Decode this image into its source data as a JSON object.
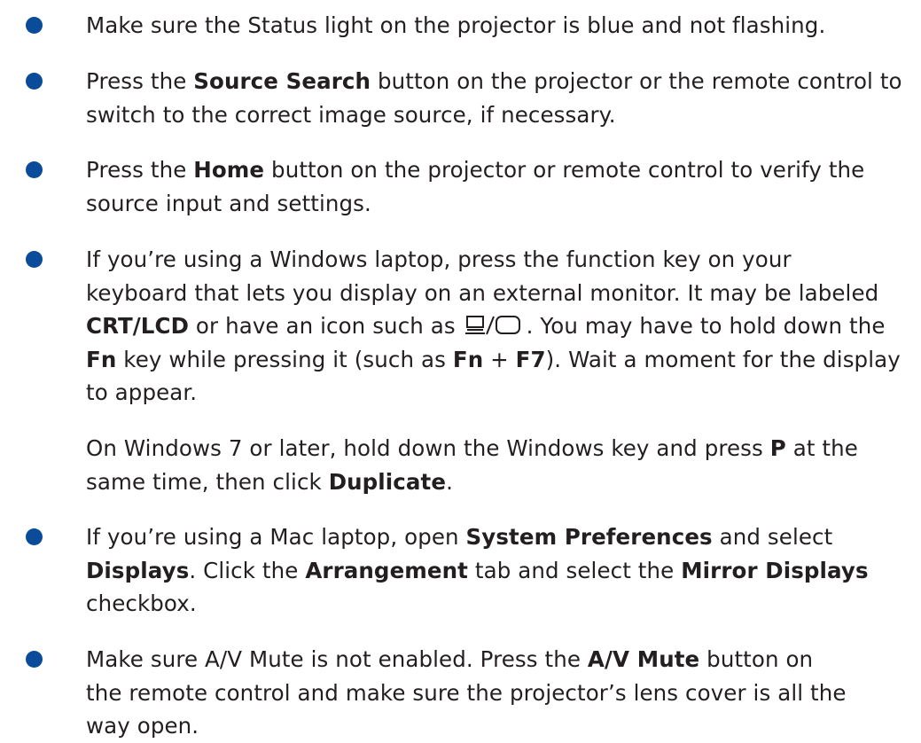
{
  "accent_color": "#0a4c99",
  "items": [
    {
      "lines": [
        [
          {
            "t": "Make sure the Status light on the projector is blue and not flashing."
          }
        ]
      ]
    },
    {
      "lines": [
        [
          {
            "t": "Press the "
          },
          {
            "t": "Source Search",
            "b": true
          },
          {
            "t": " button on the projector or the remote control to"
          }
        ],
        [
          {
            "t": "switch to the correct image source, if necessary."
          }
        ]
      ]
    },
    {
      "lines": [
        [
          {
            "t": "Press the "
          },
          {
            "t": "Home",
            "b": true
          },
          {
            "t": " button on the projector or remote control to verify the"
          }
        ],
        [
          {
            "t": "source input and settings."
          }
        ]
      ]
    },
    {
      "lines": [
        [
          {
            "t": "If you’re using a Windows laptop, press the function key on your"
          }
        ],
        [
          {
            "t": "keyboard that lets you display on an external monitor. It may be labeled"
          }
        ],
        [
          {
            "t": "CRT/LCD",
            "b": true
          },
          {
            "t": " or have an icon such as "
          },
          {
            "icon": "laptop-monitor-icon"
          },
          {
            "t": ". You may have to hold down the"
          }
        ],
        [
          {
            "t": "Fn",
            "b": true
          },
          {
            "t": " key while pressing it (such as "
          },
          {
            "t": "Fn",
            "b": true
          },
          {
            "t": " + "
          },
          {
            "t": "F7",
            "b": true
          },
          {
            "t": "). Wait a moment for the display"
          }
        ],
        [
          {
            "t": "to appear."
          }
        ]
      ]
    },
    {
      "lines": [
        [
          {
            "t": "On Windows 7 or later, hold down the Windows key and press "
          },
          {
            "t": "P",
            "b": true
          },
          {
            "t": " at the"
          }
        ],
        [
          {
            "t": "same time, then click "
          },
          {
            "t": "Duplicate",
            "b": true
          },
          {
            "t": "."
          }
        ]
      ]
    },
    {
      "lines": [
        [
          {
            "t": "If you’re using a Mac laptop, open "
          },
          {
            "t": "System Preferences",
            "b": true
          },
          {
            "t": " and select"
          }
        ],
        [
          {
            "t": "Displays",
            "b": true
          },
          {
            "t": ". Click the "
          },
          {
            "t": "Arrangement",
            "b": true
          },
          {
            "t": " tab and select the "
          },
          {
            "t": "Mirror Displays",
            "b": true
          }
        ],
        [
          {
            "t": "checkbox."
          }
        ]
      ]
    },
    {
      "lines": [
        [
          {
            "t": "Make sure A/V Mute is not enabled. Press the "
          },
          {
            "t": "A/V Mute",
            "b": true
          },
          {
            "t": " button on"
          }
        ],
        [
          {
            "t": "the remote control and make sure the projector’s lens cover is all the"
          }
        ],
        [
          {
            "t": "way open."
          }
        ]
      ]
    }
  ]
}
